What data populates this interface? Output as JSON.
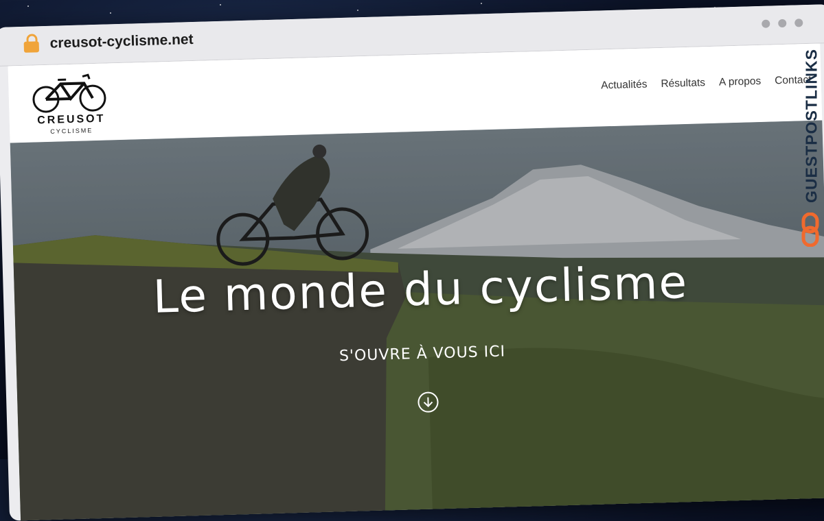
{
  "browser": {
    "url": "creusot-cyclisme.net"
  },
  "header": {
    "logo_name": "CREUSOT",
    "logo_sub": "CYCLISME",
    "nav": [
      "Actualités",
      "Résultats",
      "A propos",
      "Contact"
    ]
  },
  "hero": {
    "title": "Le monde du cyclisme",
    "subtitle": "S'OUVRE À VOUS ICI"
  },
  "watermark": {
    "text": "GUESTPOSTLINKS"
  },
  "colors": {
    "lock": "#f0a43a",
    "watermark_icon": "#f06a2e"
  }
}
